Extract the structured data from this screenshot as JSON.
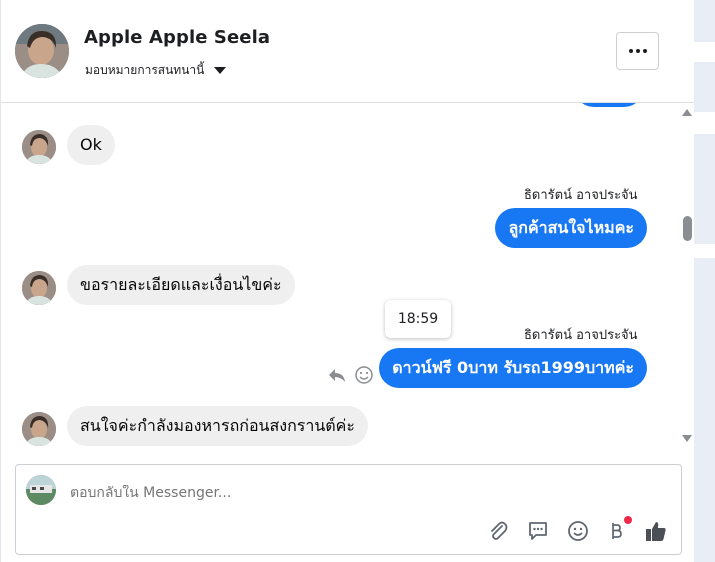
{
  "header": {
    "name": "Apple Apple Seela",
    "assign_label": "มอบหมายการสนทนานี้",
    "more_label": "more-options"
  },
  "thread": {
    "messages": [
      {
        "direction": "in",
        "text": "Ok"
      },
      {
        "direction": "out",
        "sender": "ธิดารัตน์ อาจประจัน",
        "text": "ลูกค้าสนใจไหมคะ"
      },
      {
        "direction": "in",
        "text": "ขอรายละเอียดและเงื่อนไขค่ะ"
      },
      {
        "direction": "out",
        "sender": "ธิดารัตน์ อาจประจัน",
        "text": "ดาวน์ฟรี 0บาท รับรถ1999บาทค่ะ",
        "tooltip_time": "18:59"
      },
      {
        "direction": "in",
        "text": "สนใจค่ะกำลังมองหารถก่อนสงกรานต์ค่ะ"
      }
    ]
  },
  "composer": {
    "placeholder": "ตอบกลับใน Messenger..."
  },
  "icons": {
    "tools": [
      "paperclip-icon",
      "saved-reply-icon",
      "emoji-icon",
      "baht-icon",
      "thumbs-up-icon"
    ],
    "accent": "#1877f2",
    "notification_dot": "#f02849"
  }
}
